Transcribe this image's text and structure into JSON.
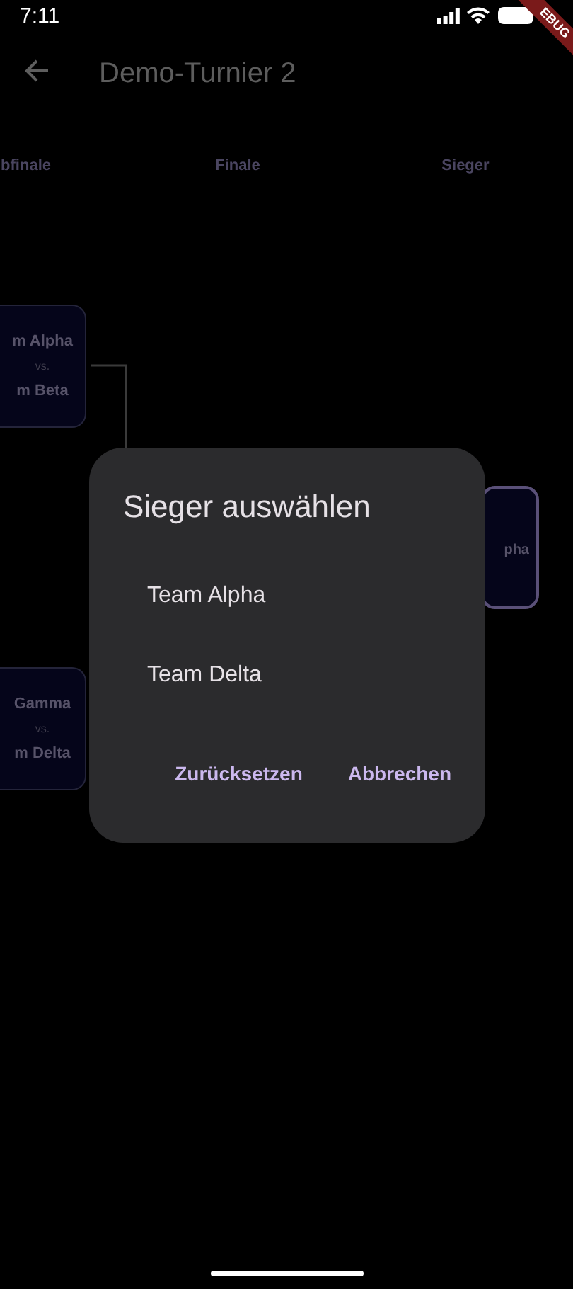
{
  "status_bar": {
    "time": "7:11"
  },
  "debug_banner": {
    "text": "EBUG"
  },
  "app_bar": {
    "title": "Demo-Turnier 2"
  },
  "bracket": {
    "round_labels": [
      "bfinale",
      "Finale",
      "Sieger"
    ],
    "matches": [
      {
        "team_1": "m Alpha",
        "separator": "vs.",
        "team_2": "m Beta"
      },
      {
        "team_1": "Gamma",
        "separator": "vs.",
        "team_2": "m Delta"
      }
    ],
    "winner": {
      "text": "pha"
    }
  },
  "dialog": {
    "title": "Sieger auswählen",
    "options": [
      "Team Alpha",
      "Team Delta"
    ],
    "actions": [
      "Zurücksetzen",
      "Abbrechen"
    ]
  }
}
